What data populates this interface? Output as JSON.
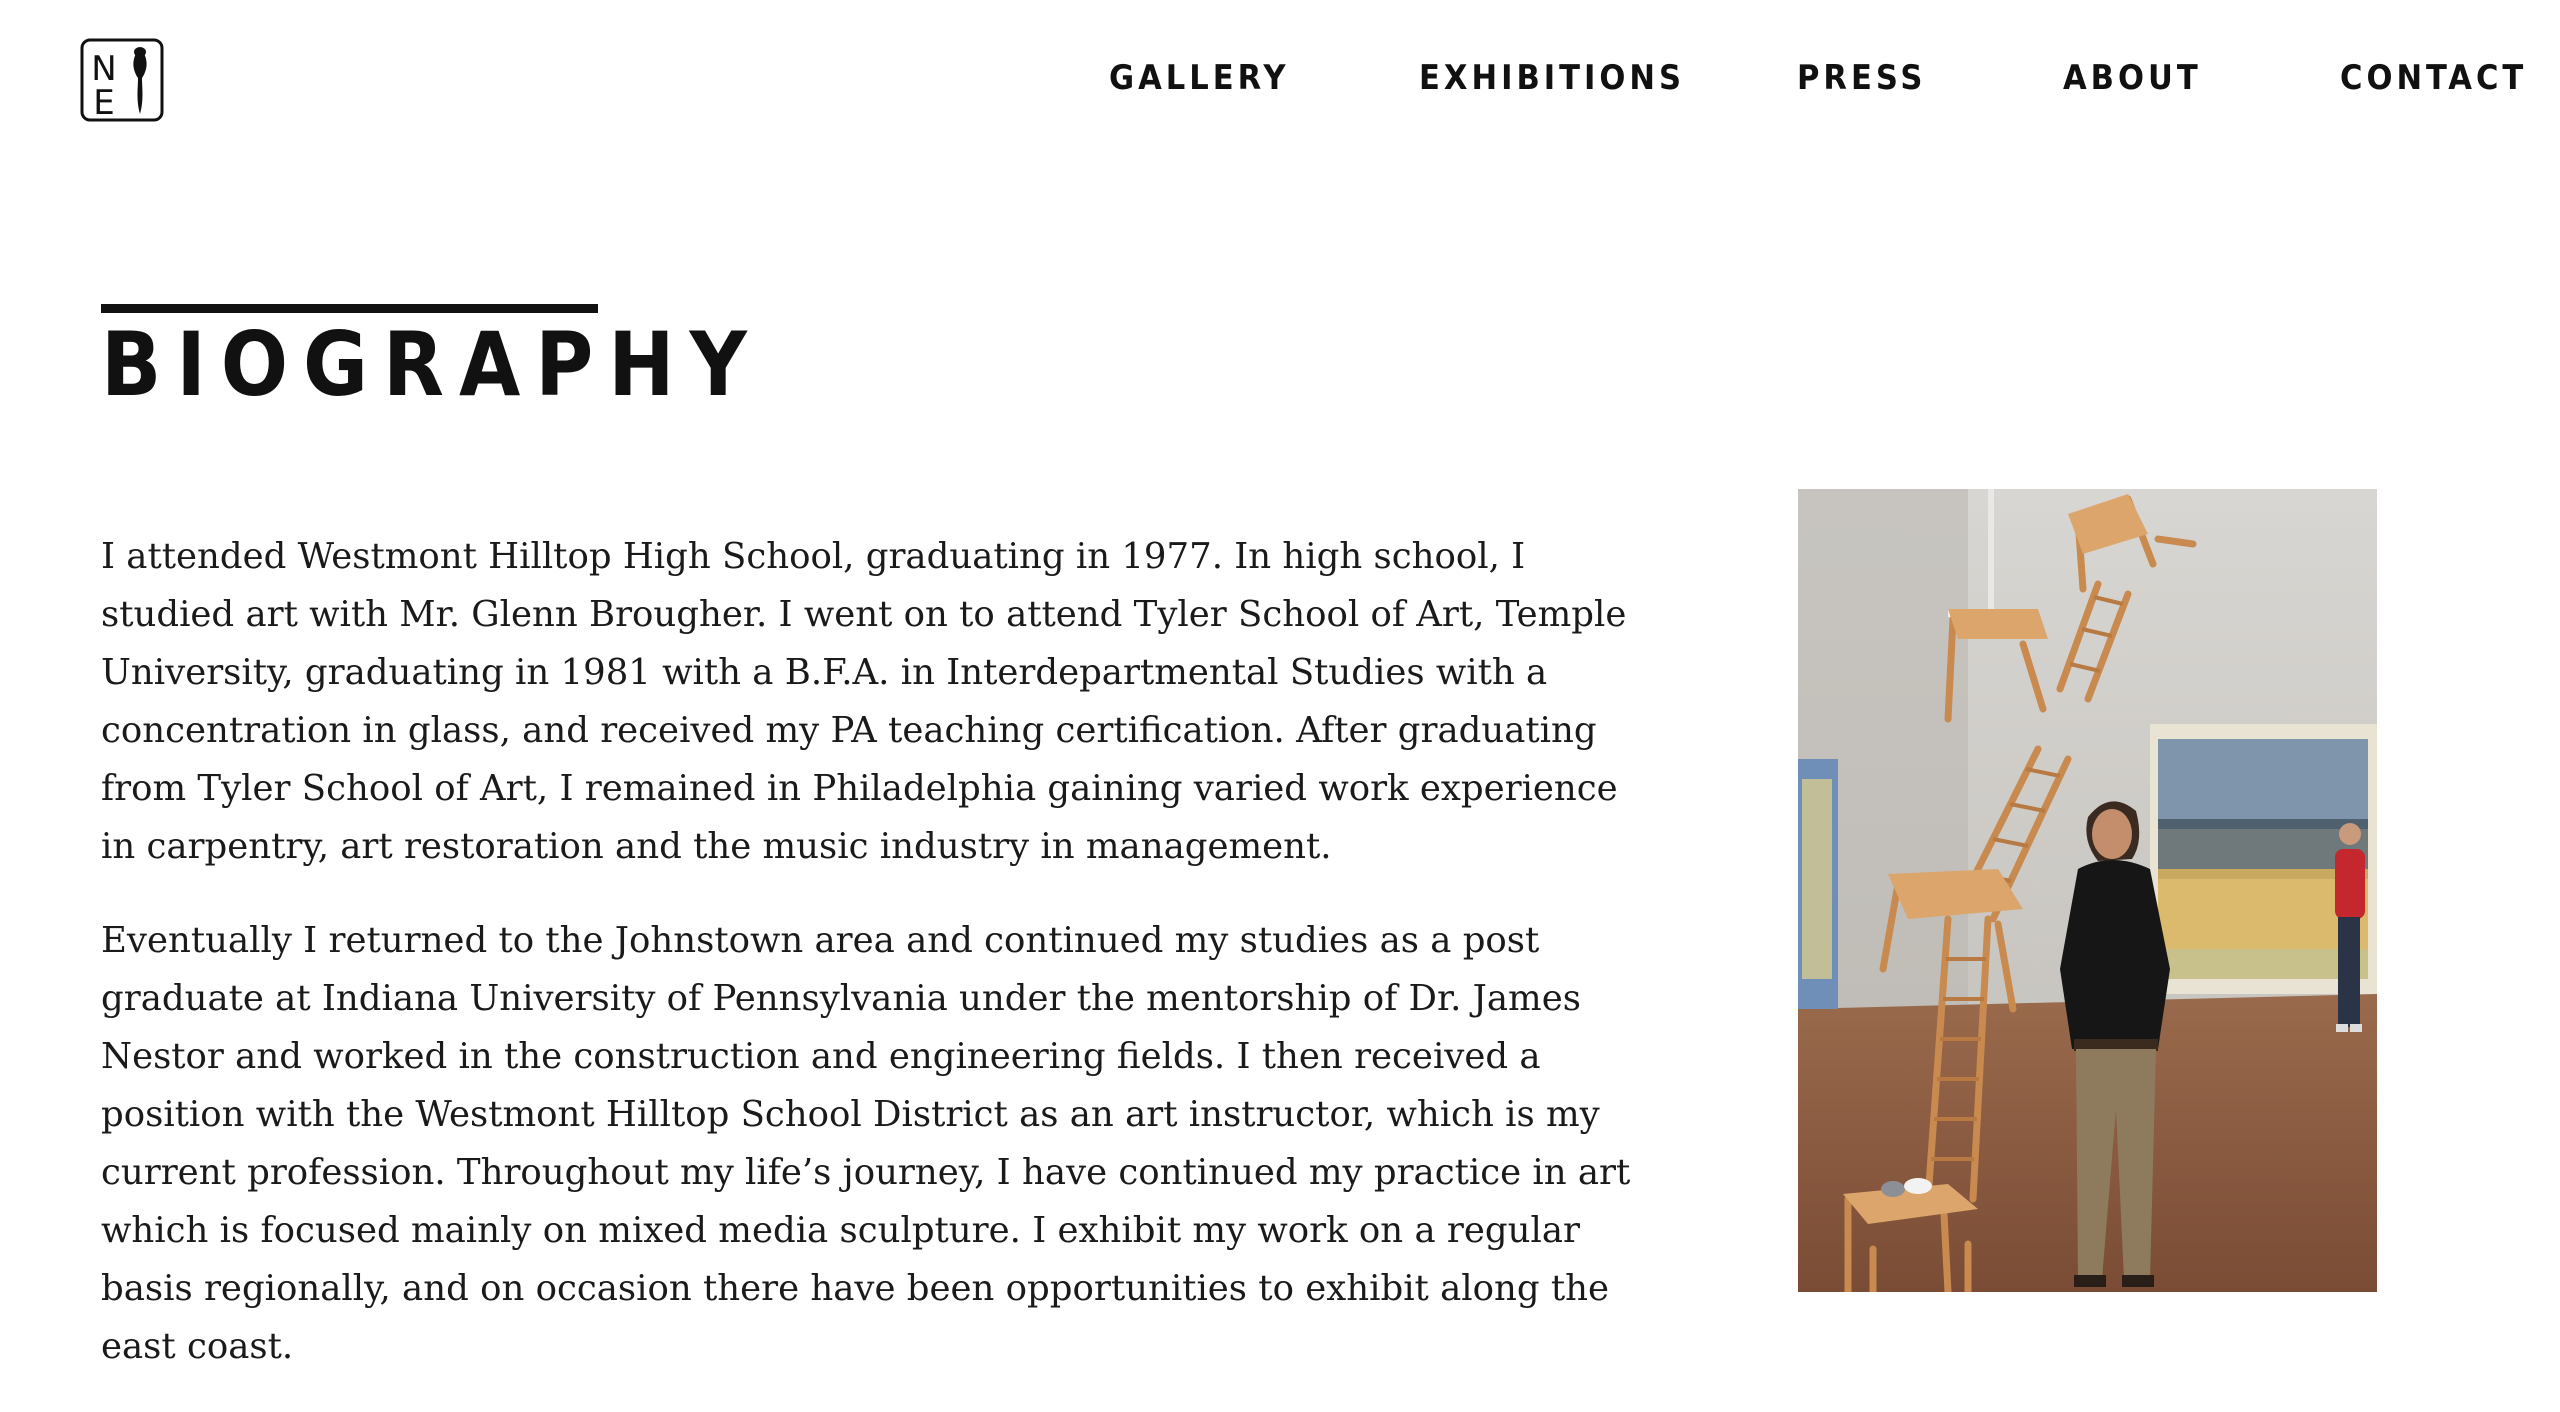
{
  "header": {
    "logo": {
      "letters": "NE",
      "alt": "NE logo"
    },
    "nav": [
      {
        "label": "GALLERY"
      },
      {
        "label": "EXHIBITIONS"
      },
      {
        "label": "PRESS"
      },
      {
        "label": "ABOUT"
      },
      {
        "label": "CONTACT"
      }
    ]
  },
  "page": {
    "title": "BIOGRAPHY",
    "paragraphs": [
      "I attended Westmont Hilltop High School,  graduating in 1977. In high school, I studied art with Mr. Glenn Brougher. I went on to attend Tyler School of Art, Temple University, graduating in 1981 with a B.F.A. in Interdepartmental Studies with a concentration in glass, and received my PA teaching certification. After graduating from Tyler School of Art, I remained in Philadelphia gaining varied work experience in carpentry, art restoration and the music industry in management.",
      "Eventually I returned to the Johnstown area and continued my studies as a post graduate at Indiana University of Pennsylvania under the mentorship of Dr. James Nestor and worked in the construction and engineering fields. I then received a position with the Westmont Hilltop School District as an art instructor, which is my current profession. Throughout my life’s journey, I have continued my practice in art which is focused mainly on  mixed media sculpture. I exhibit my work on a regular basis regionally, and on occasion there have been opportunities to exhibit along the east coast."
    ]
  },
  "colors": {
    "text": "#111111",
    "background": "#ffffff",
    "wood": "#d9a06a",
    "floor": "#8a5a3f",
    "wall": "#c9c7c3"
  }
}
